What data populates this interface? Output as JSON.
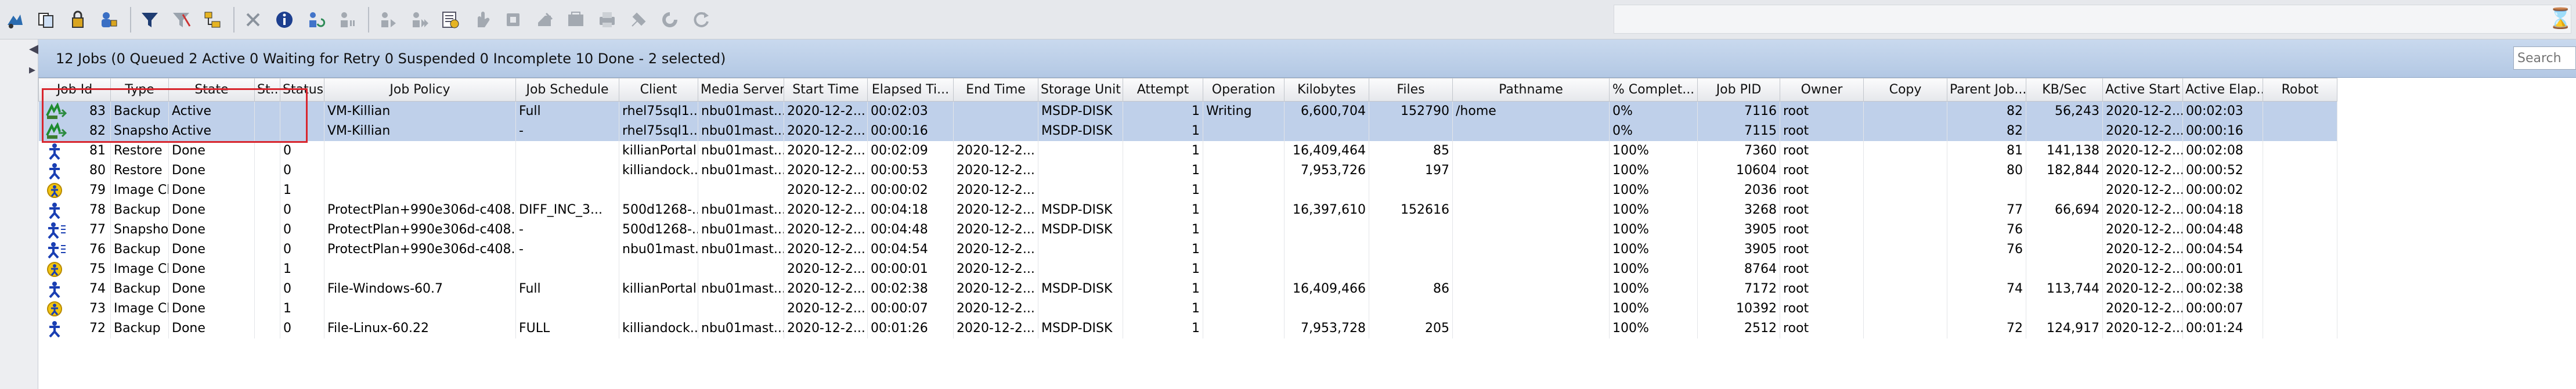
{
  "toolbar": {
    "icons": [
      "jobs-manage-icon",
      "copy-icon",
      "lock-icon",
      "user-lock-icon",
      "filter-icon",
      "clear-filter-icon",
      "tree-icon",
      "cancel-icon",
      "info-icon",
      "restart-icon",
      "suspend-icon",
      "resume-icon",
      "resume-all-icon",
      "detail-icon",
      "hand-icon",
      "stop-icon",
      "delete-icon",
      "deactivate-icon",
      "export-icon",
      "print-icon",
      "tools-icon",
      "refresh-icon"
    ],
    "hourglass": "⌛"
  },
  "summary": {
    "text": "12 Jobs (0 Queued 2 Active 0 Waiting for Retry 0 Suspended 0 Incomplete 10 Done - 2 selected)",
    "search_placeholder": "Search"
  },
  "columns": [
    "Job Id",
    "Type",
    "State",
    "St...",
    "Status",
    "Job Policy",
    "Job Schedule",
    "Client",
    "Media Server",
    "Start Time",
    "Elapsed Ti...",
    "End Time",
    "Storage Unit",
    "Attempt",
    "Operation",
    "Kilobytes",
    "Files",
    "Pathname",
    "% Complet...",
    "Job PID",
    "Owner",
    "Copy",
    "Parent Job...",
    "KB/Sec",
    "Active Start",
    "Active Elap...",
    "Robot"
  ],
  "rows": [
    {
      "icon": "running",
      "selected": true,
      "id": "83",
      "type": "Backup",
      "state": "Active",
      "st": "",
      "status": "",
      "policy": "VM-Killian",
      "schedule": "Full",
      "client": "rhel75sql1...",
      "media": "nbu01mast...",
      "start": "2020-12-2...",
      "elapsed": "00:02:03",
      "end": "",
      "storage": "MSDP-DISK",
      "attempt": "1",
      "operation": "Writing",
      "kb": "6,600,704",
      "files": "152790",
      "path": "/home",
      "pct": "0%",
      "pid": "7116",
      "owner": "root",
      "copy": "",
      "parent": "82",
      "kbsec": "56,243",
      "astart": "2020-12-2...",
      "aelapsed": "00:02:03",
      "robot": ""
    },
    {
      "icon": "running",
      "selected": true,
      "id": "82",
      "type": "Snapshot",
      "state": "Active",
      "st": "",
      "status": "",
      "policy": "VM-Killian",
      "schedule": "-",
      "client": "rhel75sql1...",
      "media": "nbu01mast...",
      "start": "2020-12-2...",
      "elapsed": "00:00:16",
      "end": "",
      "storage": "MSDP-DISK",
      "attempt": "1",
      "operation": "",
      "kb": "",
      "files": "",
      "path": "",
      "pct": "0%",
      "pid": "7115",
      "owner": "root",
      "copy": "",
      "parent": "82",
      "kbsec": "",
      "astart": "2020-12-2...",
      "aelapsed": "00:00:16",
      "robot": ""
    },
    {
      "icon": "done",
      "selected": false,
      "id": "81",
      "type": "Restore",
      "state": "Done",
      "st": "",
      "status": "0",
      "policy": "",
      "schedule": "",
      "client": "killianPortal",
      "media": "nbu01mast...",
      "start": "2020-12-2...",
      "elapsed": "00:02:09",
      "end": "2020-12-2...",
      "storage": "",
      "attempt": "1",
      "operation": "",
      "kb": "16,409,464",
      "files": "85",
      "path": "",
      "pct": "100%",
      "pid": "7360",
      "owner": "root",
      "copy": "",
      "parent": "81",
      "kbsec": "141,138",
      "astart": "2020-12-2...",
      "aelapsed": "00:02:08",
      "robot": ""
    },
    {
      "icon": "done",
      "selected": false,
      "id": "80",
      "type": "Restore",
      "state": "Done",
      "st": "",
      "status": "0",
      "policy": "",
      "schedule": "",
      "client": "killiandock...",
      "media": "nbu01mast...",
      "start": "2020-12-2...",
      "elapsed": "00:00:53",
      "end": "2020-12-2...",
      "storage": "",
      "attempt": "1",
      "operation": "",
      "kb": "7,953,726",
      "files": "197",
      "path": "",
      "pct": "100%",
      "pid": "10604",
      "owner": "root",
      "copy": "",
      "parent": "80",
      "kbsec": "182,844",
      "astart": "2020-12-2...",
      "aelapsed": "00:00:52",
      "robot": ""
    },
    {
      "icon": "cleanup",
      "selected": false,
      "id": "79",
      "type": "Image Cle...",
      "state": "Done",
      "st": "",
      "status": "1",
      "policy": "",
      "schedule": "",
      "client": "",
      "media": "",
      "start": "2020-12-2...",
      "elapsed": "00:00:02",
      "end": "2020-12-2...",
      "storage": "",
      "attempt": "1",
      "operation": "",
      "kb": "",
      "files": "",
      "path": "",
      "pct": "100%",
      "pid": "2036",
      "owner": "root",
      "copy": "",
      "parent": "",
      "kbsec": "",
      "astart": "2020-12-2...",
      "aelapsed": "00:00:02",
      "robot": ""
    },
    {
      "icon": "done",
      "selected": false,
      "id": "78",
      "type": "Backup",
      "state": "Done",
      "st": "",
      "status": "0",
      "policy": "ProtectPlan+990e306d-c408...",
      "schedule": "DIFF_INC_3...",
      "client": "500d1268-...",
      "media": "nbu01mast...",
      "start": "2020-12-2...",
      "elapsed": "00:04:18",
      "end": "2020-12-2...",
      "storage": "MSDP-DISK",
      "attempt": "1",
      "operation": "",
      "kb": "16,397,610",
      "files": "152616",
      "path": "",
      "pct": "100%",
      "pid": "3268",
      "owner": "root",
      "copy": "",
      "parent": "77",
      "kbsec": "66,694",
      "astart": "2020-12-2...",
      "aelapsed": "00:04:18",
      "robot": ""
    },
    {
      "icon": "done-tree",
      "selected": false,
      "id": "77",
      "type": "Snapshot",
      "state": "Done",
      "st": "",
      "status": "0",
      "policy": "ProtectPlan+990e306d-c408...",
      "schedule": "-",
      "client": "500d1268-...",
      "media": "nbu01mast...",
      "start": "2020-12-2...",
      "elapsed": "00:04:48",
      "end": "2020-12-2...",
      "storage": "MSDP-DISK",
      "attempt": "1",
      "operation": "",
      "kb": "",
      "files": "",
      "path": "",
      "pct": "100%",
      "pid": "3905",
      "owner": "root",
      "copy": "",
      "parent": "76",
      "kbsec": "",
      "astart": "2020-12-2...",
      "aelapsed": "00:04:48",
      "robot": ""
    },
    {
      "icon": "done-tree",
      "selected": false,
      "id": "76",
      "type": "Backup",
      "state": "Done",
      "st": "",
      "status": "0",
      "policy": "ProtectPlan+990e306d-c408...",
      "schedule": "-",
      "client": "nbu01mast...",
      "media": "nbu01mast...",
      "start": "2020-12-2...",
      "elapsed": "00:04:54",
      "end": "2020-12-2...",
      "storage": "",
      "attempt": "1",
      "operation": "",
      "kb": "",
      "files": "",
      "path": "",
      "pct": "100%",
      "pid": "3905",
      "owner": "root",
      "copy": "",
      "parent": "76",
      "kbsec": "",
      "astart": "2020-12-2...",
      "aelapsed": "00:04:54",
      "robot": ""
    },
    {
      "icon": "cleanup",
      "selected": false,
      "id": "75",
      "type": "Image Cle...",
      "state": "Done",
      "st": "",
      "status": "1",
      "policy": "",
      "schedule": "",
      "client": "",
      "media": "",
      "start": "2020-12-2...",
      "elapsed": "00:00:01",
      "end": "2020-12-2...",
      "storage": "",
      "attempt": "1",
      "operation": "",
      "kb": "",
      "files": "",
      "path": "",
      "pct": "100%",
      "pid": "8764",
      "owner": "root",
      "copy": "",
      "parent": "",
      "kbsec": "",
      "astart": "2020-12-2...",
      "aelapsed": "00:00:01",
      "robot": ""
    },
    {
      "icon": "done",
      "selected": false,
      "id": "74",
      "type": "Backup",
      "state": "Done",
      "st": "",
      "status": "0",
      "policy": "File-Windows-60.7",
      "schedule": "Full",
      "client": "killianPortal",
      "media": "nbu01mast...",
      "start": "2020-12-2...",
      "elapsed": "00:02:38",
      "end": "2020-12-2...",
      "storage": "MSDP-DISK",
      "attempt": "1",
      "operation": "",
      "kb": "16,409,466",
      "files": "86",
      "path": "",
      "pct": "100%",
      "pid": "7172",
      "owner": "root",
      "copy": "",
      "parent": "74",
      "kbsec": "113,744",
      "astart": "2020-12-2...",
      "aelapsed": "00:02:38",
      "robot": ""
    },
    {
      "icon": "cleanup",
      "selected": false,
      "id": "73",
      "type": "Image Cle...",
      "state": "Done",
      "st": "",
      "status": "1",
      "policy": "",
      "schedule": "",
      "client": "",
      "media": "",
      "start": "2020-12-2...",
      "elapsed": "00:00:07",
      "end": "2020-12-2...",
      "storage": "",
      "attempt": "1",
      "operation": "",
      "kb": "",
      "files": "",
      "path": "",
      "pct": "100%",
      "pid": "10392",
      "owner": "root",
      "copy": "",
      "parent": "",
      "kbsec": "",
      "astart": "2020-12-2...",
      "aelapsed": "00:00:07",
      "robot": ""
    },
    {
      "icon": "done",
      "selected": false,
      "id": "72",
      "type": "Backup",
      "state": "Done",
      "st": "",
      "status": "0",
      "policy": "File-Linux-60.22",
      "schedule": "FULL",
      "client": "killiandock...",
      "media": "nbu01mast...",
      "start": "2020-12-2...",
      "elapsed": "00:01:26",
      "end": "2020-12-2...",
      "storage": "MSDP-DISK",
      "attempt": "1",
      "operation": "",
      "kb": "7,953,728",
      "files": "205",
      "path": "",
      "pct": "100%",
      "pid": "2512",
      "owner": "root",
      "copy": "",
      "parent": "72",
      "kbsec": "124,917",
      "astart": "2020-12-2...",
      "aelapsed": "00:01:24",
      "robot": ""
    }
  ]
}
